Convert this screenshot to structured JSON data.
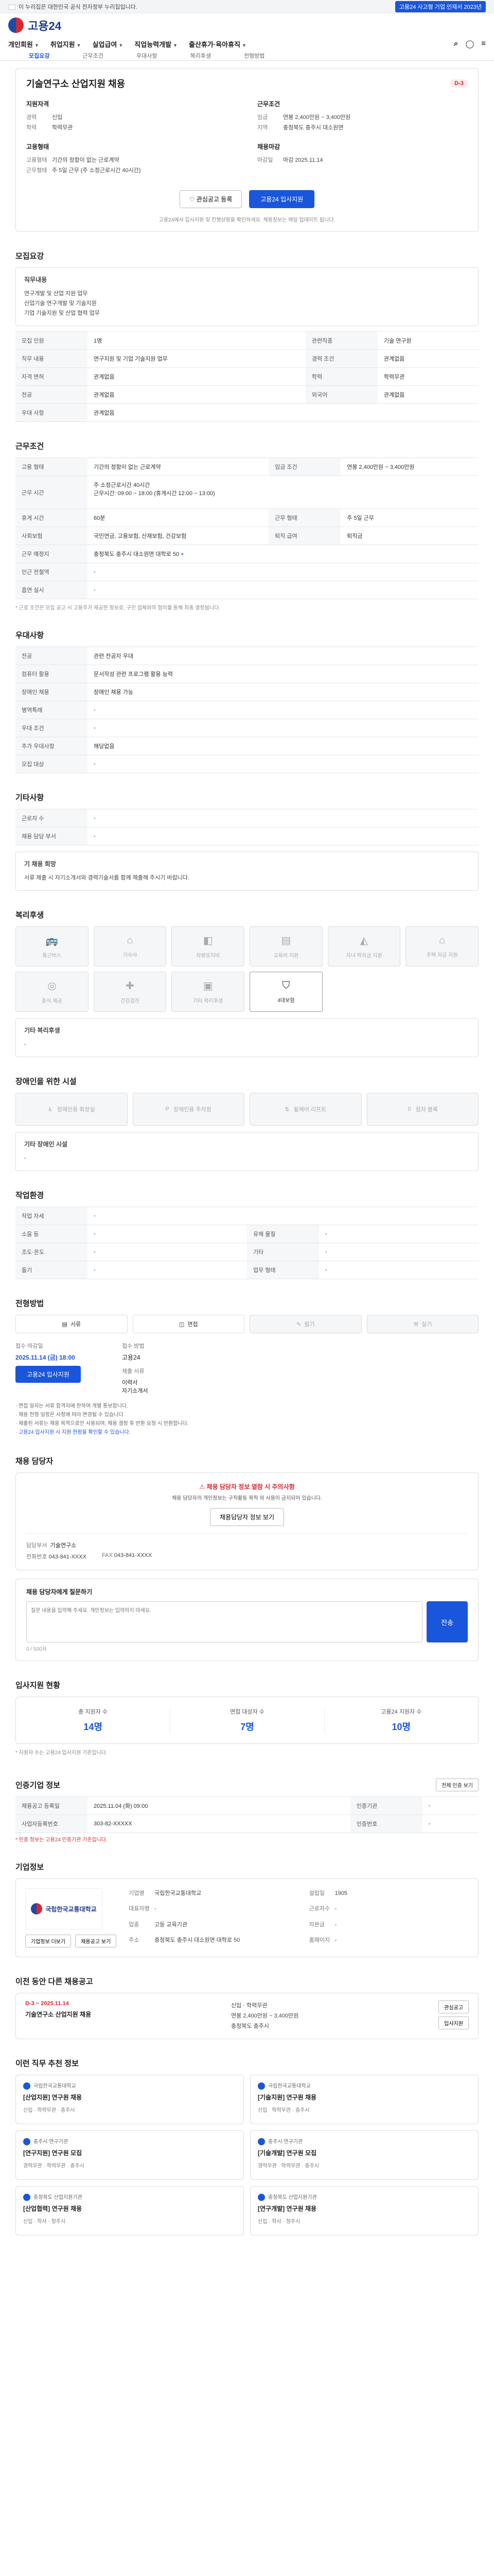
{
  "gov_banner": {
    "text": "이 누리집은 대한민국 공식 전자정부 누리집입니다.",
    "login_badge": "고용24 사고형 기업 인재서 2023년"
  },
  "logo": "고용24",
  "nav": [
    "개인회원",
    "취업지원",
    "실업급여",
    "직업능력개발",
    "출산휴가·육아휴직"
  ],
  "sub_tabs": [
    "모집요강",
    "근무조건",
    "우대사항",
    "복리후생",
    "전형방법"
  ],
  "job": {
    "title": "기술연구소 산업지원 채용",
    "d_day": "D-3",
    "left_block": {
      "heading": "지원자격",
      "rows": [
        {
          "k": "경력",
          "v": "신입"
        },
        {
          "k": "학력",
          "v": "학력무관"
        }
      ]
    },
    "right_block": {
      "heading": "근무조건",
      "rows": [
        {
          "k": "임금",
          "v": "연봉 2,400만원 ~ 3,400만원"
        },
        {
          "k": "지역",
          "v": "충청북도 충주시 대소원면"
        }
      ]
    },
    "left_block2": {
      "heading": "고용형태",
      "rows": [
        {
          "k": "고용형태",
          "v": "기간의 정함이 없는 근로계약"
        },
        {
          "k": "근무형태",
          "v": "주 5일 근무 (주 소정근로시간 40시간)"
        }
      ]
    },
    "right_block2": {
      "heading": "채용마감",
      "rows": [
        {
          "k": "마감일",
          "v": "마감 2025.11.14"
        }
      ]
    },
    "btn_interest": "관심공고 등록",
    "btn_apply": "고용24 입사지원",
    "note": "고용24에서 입사지원 및 진행상황을 확인하세요. 채용정보는 매일 업데이트 됩니다."
  },
  "recruit": {
    "title": "모집요강",
    "duties_title": "직무내용",
    "duties": [
      "연구개발 및 산업 지원 업무",
      "산업기술 연구개발 및 기술지원",
      "기업 기술지원 및 산업 협력 업무"
    ],
    "rows": [
      {
        "k": "모집 인원",
        "v": "1명",
        "k2": "관련직종",
        "v2": "기술 연구원"
      },
      {
        "k": "직무 내용",
        "v": "연구지원 및 기업 기술지원 업무",
        "k2": "경력 조건",
        "v2": "관계없음"
      },
      {
        "k": "자격 면허",
        "v": "관계없음",
        "k2": "학력",
        "v2": "학력무관"
      },
      {
        "k": "전공",
        "v": "관계없음",
        "k2": "외국어",
        "v2": "관계없음"
      },
      {
        "k": "우대 사항",
        "v": "관계없음",
        "k2": "",
        "v2": ""
      }
    ]
  },
  "work": {
    "title": "근무조건",
    "rows1": [
      {
        "k": "고용 형태",
        "v": "기간의 정함이 없는 근로계약",
        "k2": "임금 조건",
        "v2": "연봉 2,400만원 ~ 3,400만원"
      }
    ],
    "hours_label": "근무 시간",
    "hours": [
      "주 소정근로시간 40시간",
      "근무시간: 09:00 ~ 18:00 (휴게시간 12:00 ~ 13:00)"
    ],
    "rows2": [
      {
        "k": "휴게 시간",
        "v": "60분",
        "k2": "근무 형태",
        "v2": "주 5일 근무"
      },
      {
        "k": "사회보험",
        "v": "국민연금, 고용보험, 산재보험, 건강보험",
        "k2": "퇴직 급여",
        "v2": "퇴직금"
      }
    ],
    "location_label": "근무 예정지",
    "location": "충청북도 충주시 대소원면 대학로 50",
    "transport_label": "인근 전철역",
    "transport": "-",
    "smoking_label": "흡연 실시",
    "smoking": "-",
    "note": "* 근로 조건은 모집 공고 시 고용주가 제공한 정보로, 구인 업체와의 협의를 통해 최종 결정됩니다."
  },
  "prefer": {
    "title": "우대사항",
    "rows": [
      {
        "k": "전공",
        "v": "관련 전공자 우대"
      },
      {
        "k": "컴퓨터 활용",
        "v": "문서작성 관련 프로그램 활용 능력"
      },
      {
        "k": "장애인 채용",
        "v": "장애인 채용 가능"
      },
      {
        "k": "병역특례",
        "v": "-"
      },
      {
        "k": "우대 조건",
        "v": "-"
      },
      {
        "k": "추가 우대사항",
        "v": "해당없음"
      },
      {
        "k": "모집 대상",
        "v": "-"
      }
    ]
  },
  "etc": {
    "title": "기타사항",
    "rows": [
      {
        "k": "근로자 수",
        "v": "-"
      },
      {
        "k": "채용 담당 부서",
        "v": "-"
      }
    ],
    "extra_title": "기 채용 희망",
    "extra_text": "서류 제출 시 자기소개서와 경력기술서를 함께 제출해 주시기 바랍니다."
  },
  "welfare": {
    "title": "복리후생",
    "tiles": [
      "통근버스",
      "기숙사",
      "차량유지비",
      "교육비 지원",
      "자녀 학자금 지원",
      "주택 자금 지원",
      "중식 제공",
      "건강검진",
      "기타 복리후생",
      "4대보험"
    ],
    "note_title": "기타 복리후생",
    "note": "-"
  },
  "accessibility": {
    "title": "장애인을 위한 시설",
    "tiles": [
      "장애인용 화장실",
      "장애인용 주차장",
      "휠체어 리프트",
      "점자 블록"
    ],
    "note_title": "기타 장애인 시설",
    "note": "-"
  },
  "env": {
    "title": "작업환경",
    "rows": [
      {
        "k": "작업 자세",
        "v": "-",
        "k2": "",
        "v2": ""
      },
      {
        "k": "소음 등",
        "v": "-",
        "k2": "유해 물질",
        "v2": "-"
      },
      {
        "k": "조도·온도",
        "v": "-",
        "k2": "기타",
        "v2": "-"
      },
      {
        "k": "들기",
        "v": "-",
        "k2": "업무 형태",
        "v2": "-"
      }
    ]
  },
  "selection": {
    "title": "전형방법",
    "methods": [
      "서류",
      "면접",
      "필기",
      "실기"
    ],
    "deadline_label": "접수 마감일",
    "deadline": "2025.11.14 (금) 18:00",
    "apply_btn": "고용24 입사지원",
    "method_label": "접수 방법",
    "method": "고용24",
    "docs_label": "제출 서류",
    "docs": [
      "이력서",
      "자기소개서"
    ],
    "notices": [
      "· 면접 일자는 서류 합격자에 한하여 개별 통보합니다.",
      "· 채용 전형 일정은 사정에 따라 변경될 수 있습니다.",
      "· 제출된 서류는 채용 목적으로만 사용되며, 채용 결정 후 반환 요청 시 반환합니다.",
      "· 고용24 입사지원 시 지원 현황을 확인할 수 있습니다."
    ]
  },
  "contact": {
    "title": "채용 담당자",
    "warn_title": "채용 담당자 정보 열람 시 주의사항",
    "warn_text": "채용 담당자의 개인정보는 구직활동 목적 외 사용이 금지되어 있습니다.",
    "view_btn": "채용담당자 정보 보기",
    "dept_label": "담당부서",
    "dept": "기술연구소",
    "tel_label": "전화번호",
    "tel": "043-841-XXXX",
    "fax_label": "FAX",
    "fax": "043-841-XXXX"
  },
  "inquiry": {
    "title": "채용 담당자에게 질문하기",
    "placeholder": "질문 내용을 입력해 주세요. 개인정보는 입력하지 마세요.",
    "btn": "전송",
    "counter": "0 / 500자"
  },
  "stats": {
    "title": "입사지원 현황",
    "items": [
      {
        "k": "총 지원자 수",
        "v": "14명"
      },
      {
        "k": "면접 대상자 수",
        "v": "7명"
      },
      {
        "k": "고용24 지원자 수",
        "v": "10명"
      }
    ],
    "note": "* 지원자 수는 고용24 입사지원 기준입니다."
  },
  "registry": {
    "title": "인증기업 정보",
    "more": "전체 인증 보기",
    "rows": [
      {
        "k": "채용공고 등록일",
        "v": "2025.11.04 (화) 09:00",
        "k2": "인증기관",
        "v2": "-"
      },
      {
        "k": "사업자등록번호",
        "v": "303-82-XXXXX",
        "k2": "인증번호",
        "v2": "-"
      }
    ],
    "note": "* 인증 정보는 고용24 인증기관 기준입니다."
  },
  "company": {
    "title": "기업정보",
    "logo_text": "국립한국교통대학교",
    "rows": [
      {
        "k": "기업명",
        "v": "국립한국교통대학교",
        "k2": "설립일",
        "v2": "1905"
      },
      {
        "k": "대표자명",
        "v": "-",
        "k2": "근로자수",
        "v2": "-"
      },
      {
        "k": "업종",
        "v": "고등 교육기관",
        "k2": "자본금",
        "v2": "-"
      },
      {
        "k": "주소",
        "v": "충청북도 충주시 대소원면 대학로 50",
        "k2": "홈페이지",
        "v2": "-"
      }
    ],
    "btn_more": "기업정보 더보기",
    "btn_jobs": "채용공고 보기"
  },
  "previous": {
    "title": "이전 동안 다른 채용공고",
    "date": "D-3 ~ 2025.11.14",
    "job_title": "기술연구소 산업지원 채용",
    "info": [
      "신입 · 학력무관",
      "연봉 2,400만원 ~ 3,400만원",
      "충청북도 충주시"
    ],
    "btn_interest": "관심공고",
    "btn_apply": "입사지원"
  },
  "recommend": {
    "title": "이런 직무 추천 정보",
    "items": [
      {
        "co": "국립한국교통대학교",
        "title": "[산업지원] 연구원 채용",
        "meta": "신입 · 학력무관 · 충주시"
      },
      {
        "co": "국립한국교통대학교",
        "title": "[기술지원] 연구원 채용",
        "meta": "신입 · 학력무관 · 충주시"
      },
      {
        "co": "충주시 연구기관",
        "title": "[연구지원] 연구원 모집",
        "meta": "경력무관 · 학력무관 · 충주시"
      },
      {
        "co": "충주시 연구기관",
        "title": "[기술개발] 연구원 모집",
        "meta": "경력무관 · 학력무관 · 충주시"
      },
      {
        "co": "충청북도 산업지원기관",
        "title": "[산업협력] 연구원 채용",
        "meta": "신입 · 학사 · 청주시"
      },
      {
        "co": "충청북도 산업지원기관",
        "title": "[연구개발] 연구원 채용",
        "meta": "신입 · 학사 · 청주시"
      }
    ]
  }
}
